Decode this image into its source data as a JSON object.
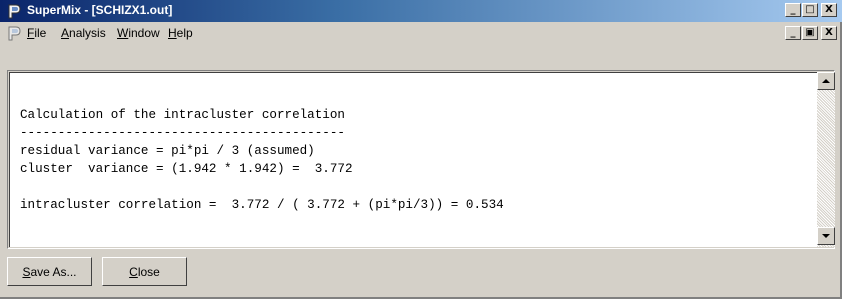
{
  "window": {
    "title": "SuperMix - [SCHIZX1.out]"
  },
  "titlebar_controls": {
    "minimize": "_",
    "maximize": "□",
    "close": "X"
  },
  "mdi_controls": {
    "minimize": "_",
    "restore": "▣",
    "close": "X"
  },
  "menu": {
    "items": [
      {
        "mnemonic": "F",
        "rest": "ile"
      },
      {
        "mnemonic": "A",
        "rest": "nalysis"
      },
      {
        "mnemonic": "W",
        "rest": "indow"
      },
      {
        "mnemonic": "H",
        "rest": "elp"
      }
    ]
  },
  "output": {
    "lines": [
      "Calculation of the intracluster correlation",
      "-------------------------------------------",
      "residual variance = pi*pi / 3 (assumed)",
      "cluster  variance = (1.942 * 1.942) =  3.772",
      "",
      "intracluster correlation =  3.772 / ( 3.772 + (pi*pi/3)) = 0.534"
    ]
  },
  "buttons": {
    "save": {
      "mnemonic": "S",
      "rest": "ave As..."
    },
    "close": {
      "mnemonic": "C",
      "rest": "lose"
    }
  },
  "colors": {
    "title_gradient_start": "#0a246a",
    "title_gradient_end": "#a6caf0",
    "face": "#d4d0c8"
  }
}
